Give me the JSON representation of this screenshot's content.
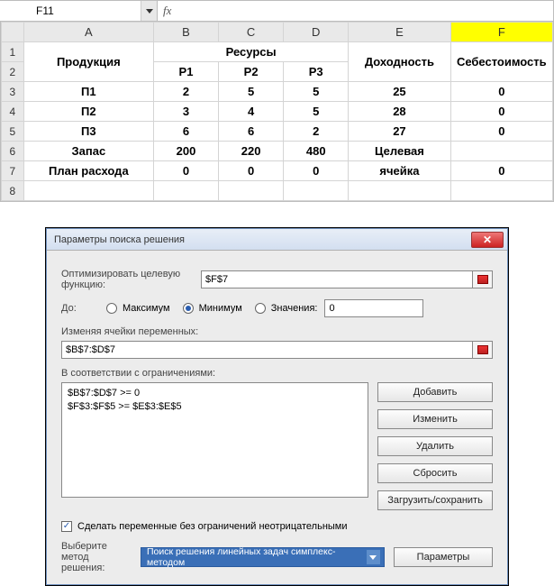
{
  "nameBox": "F11",
  "fxLabel": "fx",
  "columns": [
    "A",
    "B",
    "C",
    "D",
    "E",
    "F"
  ],
  "rows": [
    "1",
    "2",
    "3",
    "4",
    "5",
    "6",
    "7",
    "8"
  ],
  "selectedCol": "F",
  "cells": {
    "r1": {
      "A": "Продукция",
      "C": "Ресурсы",
      "E": "Доходность",
      "F": "Себестоимость"
    },
    "r2": {
      "B": "Р1",
      "C": "Р2",
      "D": "Р3"
    },
    "r3": {
      "A": "П1",
      "B": "2",
      "C": "5",
      "D": "5",
      "E": "25",
      "F": "0"
    },
    "r4": {
      "A": "П2",
      "B": "3",
      "C": "4",
      "D": "5",
      "E": "28",
      "F": "0"
    },
    "r5": {
      "A": "П3",
      "B": "6",
      "C": "6",
      "D": "2",
      "E": "27",
      "F": "0"
    },
    "r6": {
      "A": "Запас",
      "B": "200",
      "C": "220",
      "D": "480",
      "E": "Целевая"
    },
    "r7": {
      "A": "План расхода",
      "B": "0",
      "C": "0",
      "D": "0",
      "E": "ячейка",
      "F": "0"
    }
  },
  "dialog": {
    "title": "Параметры поиска решения",
    "optimizeLabel": "Оптимизировать целевую функцию:",
    "optimizeValue": "$F$7",
    "toLabel": "До:",
    "radioMax": "Максимум",
    "radioMin": "Минимум",
    "radioValue": "Значения:",
    "valueField": "0",
    "varsLabel": "Изменяя ячейки переменных:",
    "varsValue": "$B$7:$D$7",
    "constraintsLabel": "В соответствии с ограничениями:",
    "constraints": [
      "$B$7:$D$7 >= 0",
      "$F$3:$F$5 >= $E$3:$E$5"
    ],
    "btnAdd": "Добавить",
    "btnChange": "Изменить",
    "btnDelete": "Удалить",
    "btnReset": "Сбросить",
    "btnLoadSave": "Загрузить/сохранить",
    "checkboxLabel": "Сделать переменные без ограничений неотрицательными",
    "methodLabel1": "Выберите",
    "methodLabel2": "метод решения:",
    "methodValue": "Поиск решения линейных задач симплекс-методом",
    "btnParams": "Параметры"
  }
}
